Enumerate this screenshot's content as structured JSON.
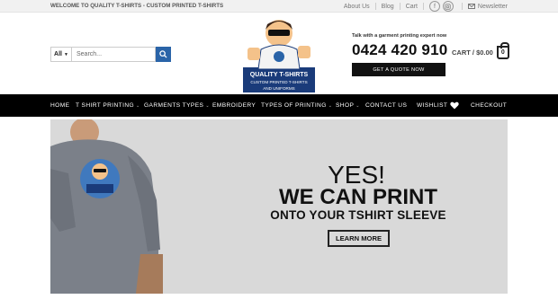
{
  "topbar": {
    "welcome": "WELCOME TO QUALITY T-SHIRTS - CUSTOM PRINTED T-SHIRTS",
    "about": "About Us",
    "blog": "Blog",
    "cart": "Cart",
    "newsletter": "Newsletter"
  },
  "search": {
    "category": "All",
    "placeholder": "Search..."
  },
  "logo": {
    "line1": "QUALITY T-SHIRTS",
    "line2": "CUSTOM PRINTED T-SHIRTS",
    "line3": "AND UNIFORMS"
  },
  "contact": {
    "talk": "Talk with a garment printing expert now",
    "phone": "0424 420 910",
    "quote_button": "GET A QUOTE NOW"
  },
  "cart": {
    "label": "CART / $0.00",
    "count": "0"
  },
  "nav": {
    "items": [
      "HOME",
      "T SHIRT PRINTING",
      "GARMENTS TYPES",
      "EMBROIDERY",
      "TYPES OF PRINTING",
      "SHOP",
      "CONTACT US",
      "WISHLIST",
      "CHECKOUT"
    ]
  },
  "banner": {
    "yes": "YES!",
    "headline": "WE CAN PRINT",
    "subline": "ONTO YOUR TSHIRT SLEEVE",
    "button": "LEARN MORE"
  },
  "colors": {
    "accent": "#2a64a8",
    "nav_bg": "#000000",
    "banner_bg": "#d9d9d9"
  }
}
